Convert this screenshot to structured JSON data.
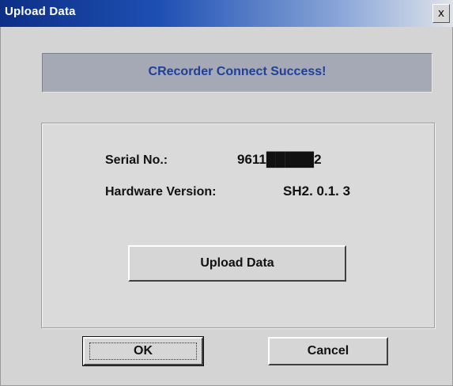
{
  "window": {
    "title": "Upload Data",
    "close_glyph": "x"
  },
  "banner": {
    "message": "CRecorder Connect Success!"
  },
  "device_info": {
    "serial_label": "Serial No.:",
    "serial_value": "9611█████2",
    "hardware_label": "Hardware Version:",
    "hardware_value": "SH2. 0.1. 3"
  },
  "buttons": {
    "upload_label": "Upload Data",
    "ok_label": "OK",
    "cancel_label": "Cancel"
  },
  "colors": {
    "banner_text": "#1f3f9a",
    "title_bar_start": "#0d2f86"
  }
}
